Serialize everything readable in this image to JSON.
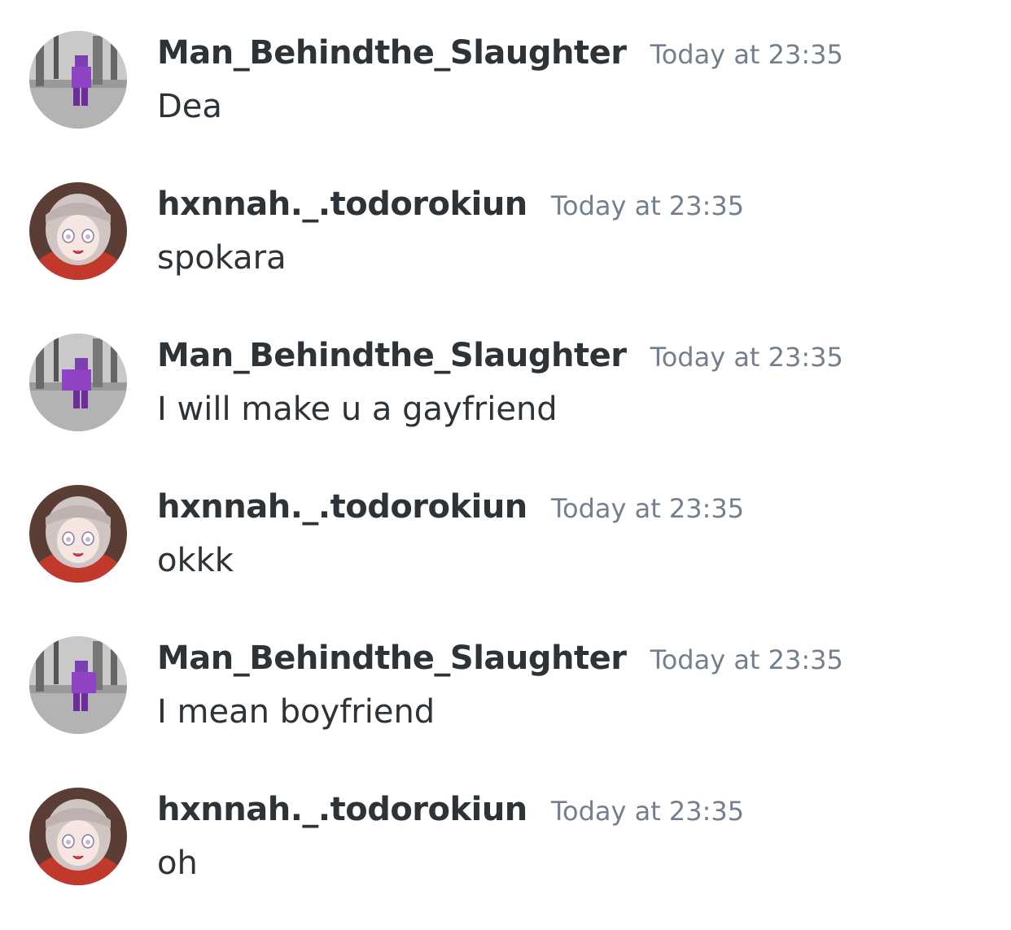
{
  "messages": [
    {
      "author": "Man_Behindthe_Slaughter",
      "timestamp": "Today at 23:35",
      "text": "Dea",
      "avatar": "roblox-avatar"
    },
    {
      "author": "hxnnah._.todorokiun",
      "timestamp": "Today at 23:35",
      "text": "spokara",
      "avatar": "anime-avatar"
    },
    {
      "author": "Man_Behindthe_Slaughter",
      "timestamp": "Today at 23:35",
      "text": "I will make u a gayfriend",
      "avatar": "roblox-avatar"
    },
    {
      "author": "hxnnah._.todorokiun",
      "timestamp": "Today at 23:35",
      "text": "okkk",
      "avatar": "anime-avatar"
    },
    {
      "author": "Man_Behindthe_Slaughter",
      "timestamp": "Today at 23:35",
      "text": "I mean boyfriend",
      "avatar": "roblox-avatar"
    },
    {
      "author": "hxnnah._.todorokiun",
      "timestamp": "Today at 23:35",
      "text": "oh",
      "avatar": "anime-avatar"
    }
  ],
  "colors": {
    "username": "#2e3338",
    "timestamp": "#747f8d",
    "text": "#2e3338",
    "background": "#ffffff"
  }
}
